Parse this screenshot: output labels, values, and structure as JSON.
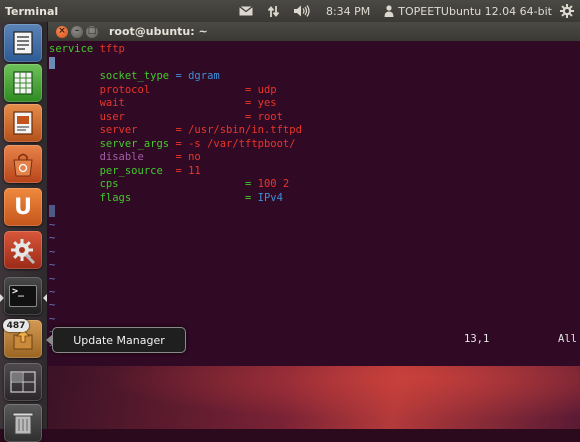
{
  "top_panel": {
    "app_title": "Terminal",
    "clock": "8:34 PM",
    "user": "TOPEETUbuntu 12.04 64-bit",
    "icons": [
      "mail-icon",
      "network-icon",
      "volume-icon",
      "clock",
      "user-icon",
      "gear-icon"
    ]
  },
  "launcher": {
    "items": [
      {
        "name": "dash-home",
        "icon": "file-document-icon"
      },
      {
        "name": "libreoffice-calc",
        "icon": "spreadsheet-icon"
      },
      {
        "name": "libreoffice-impress",
        "icon": "presentation-icon"
      },
      {
        "name": "ubuntu-software-center",
        "icon": "shopping-bag-icon"
      },
      {
        "name": "ubuntu-one",
        "icon": "ubuntu-one-icon"
      },
      {
        "name": "system-settings",
        "icon": "gear-wrench-icon"
      },
      {
        "name": "terminal",
        "icon": "terminal-icon",
        "active": true
      },
      {
        "name": "update-manager",
        "icon": "update-icon",
        "badge": "487"
      },
      {
        "name": "workspace-switcher",
        "icon": "workspace-icon"
      },
      {
        "name": "trash",
        "icon": "trash-icon"
      }
    ],
    "badge_text": "487",
    "ubuntu_one_glyph": "U",
    "terminal_glyph": ">_"
  },
  "tooltip": {
    "text": "Update Manager"
  },
  "window": {
    "title": "root@ubuntu: ~",
    "close_glyph": "×",
    "min_glyph": "–",
    "max_glyph": "□"
  },
  "terminal": {
    "line1_kw": "service",
    "line1_val": "tftp",
    "brace_open": "{",
    "brace_close": "}",
    "entries": [
      {
        "key": "socket_type",
        "eq": "=",
        "val": "dgram"
      },
      {
        "key": "protocol",
        "eq": "=",
        "val": "udp"
      },
      {
        "key": "wait",
        "eq": "=",
        "val": "yes"
      },
      {
        "key": "user",
        "eq": "=",
        "val": "root"
      },
      {
        "key": "server",
        "eq": "=",
        "val": "/usr/sbin/in.tftpd"
      },
      {
        "key": "server_args",
        "eq": "=",
        "val": "-s /var/tftpboot/"
      },
      {
        "key": "disable",
        "eq": "=",
        "val": "no"
      },
      {
        "key": "per_source",
        "eq": "=",
        "val": "11"
      },
      {
        "key": "cps",
        "eq": "=",
        "val": "100 2"
      },
      {
        "key": "flags",
        "eq": "=",
        "val": "IPv4"
      }
    ],
    "tilde": "~",
    "status_position": "13,1",
    "status_scope": "All"
  },
  "colors": {
    "terminal_bg": "#300a24",
    "keyword": "#43c92c",
    "value": "#e8352a",
    "assign": "#3d8ed8",
    "comment_key": "#a15ea8"
  }
}
